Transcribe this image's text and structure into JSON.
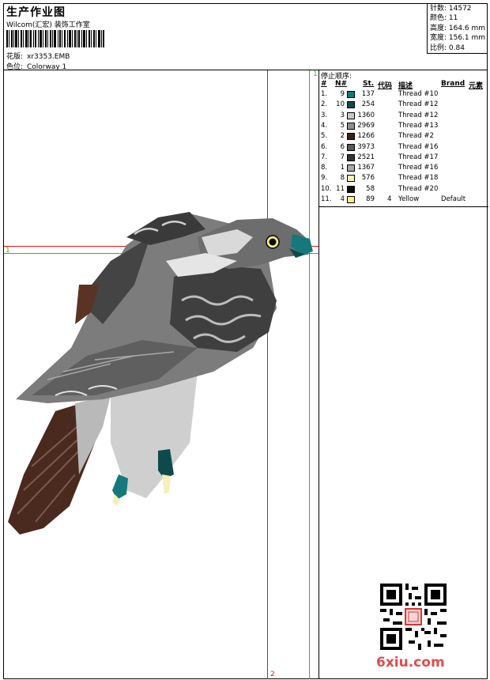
{
  "header": {
    "title": "生产作业图",
    "company": "Wilcom(汇宏) 装饰工作室",
    "design_label": "花版:",
    "design_value": "xr3353.EMB",
    "colorway_label": "色位:",
    "colorway_value": "Colorway 1"
  },
  "stats": {
    "stitches": "针数: 14572",
    "colors": "颜色: 11",
    "height": "高度: 164.6 mm",
    "width": "宽度: 156.1 mm",
    "scale": "比例: 0.84"
  },
  "panel": {
    "title": "停止顺序:",
    "columns": {
      "index": "#",
      "number": "N#",
      "stitches": "St.",
      "code": "代码",
      "description": "描述",
      "brand": "Brand",
      "element": "元素"
    },
    "rows": [
      {
        "index": "1.",
        "number": "9",
        "stitches": "137",
        "code": "",
        "description": "Thread #10",
        "brand": "",
        "color": "#13797b"
      },
      {
        "index": "2.",
        "number": "10",
        "stitches": "254",
        "code": "",
        "description": "Thread #12",
        "brand": "",
        "color": "#0e4a4c"
      },
      {
        "index": "3.",
        "number": "3",
        "stitches": "1360",
        "code": "",
        "description": "Thread #12",
        "brand": "",
        "color": "#c8c8c8"
      },
      {
        "index": "4.",
        "number": "5",
        "stitches": "2969",
        "code": "",
        "description": "Thread #13",
        "brand": "",
        "color": "#8f8f8f"
      },
      {
        "index": "5.",
        "number": "2",
        "stitches": "1266",
        "code": "",
        "description": "Thread #2",
        "brand": "",
        "color": "#3c2119"
      },
      {
        "index": "6.",
        "number": "6",
        "stitches": "3973",
        "code": "",
        "description": "Thread #16",
        "brand": "",
        "color": "#595959"
      },
      {
        "index": "7.",
        "number": "7",
        "stitches": "2521",
        "code": "",
        "description": "Thread #17",
        "brand": "",
        "color": "#333333"
      },
      {
        "index": "8.",
        "number": "1",
        "stitches": "1367",
        "code": "",
        "description": "Thread #16",
        "brand": "",
        "color": "#a9a9a9"
      },
      {
        "index": "9.",
        "number": "8",
        "stitches": "576",
        "code": "",
        "description": "Thread #18",
        "brand": "",
        "color": "#f5efb8"
      },
      {
        "index": "10.",
        "number": "11",
        "stitches": "58",
        "code": "",
        "description": "Thread #20",
        "brand": "",
        "color": "#0d0d0d"
      },
      {
        "index": "11.",
        "number": "4",
        "stitches": "89",
        "code": "4",
        "description": "Yellow",
        "brand": "Default",
        "color": "#f7f08c"
      }
    ]
  },
  "guides": {
    "h1": "1",
    "v1": "1",
    "v2": "2"
  },
  "watermark": "6xiu.com",
  "colors": {
    "guide_red": "#e3141b",
    "guide_green": "#14c814"
  }
}
